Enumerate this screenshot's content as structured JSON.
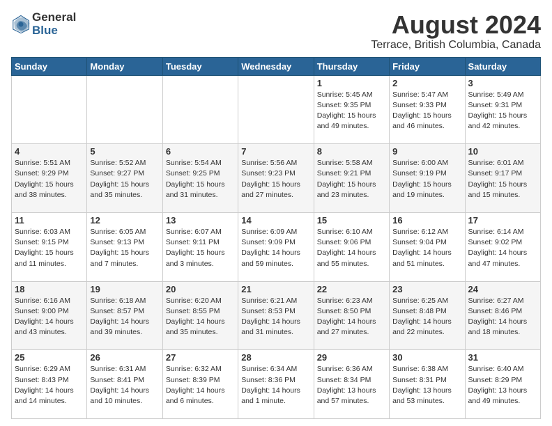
{
  "header": {
    "logo_line1": "General",
    "logo_line2": "Blue",
    "title": "August 2024",
    "subtitle": "Terrace, British Columbia, Canada"
  },
  "days_of_week": [
    "Sunday",
    "Monday",
    "Tuesday",
    "Wednesday",
    "Thursday",
    "Friday",
    "Saturday"
  ],
  "weeks": [
    [
      {
        "day": "",
        "info": ""
      },
      {
        "day": "",
        "info": ""
      },
      {
        "day": "",
        "info": ""
      },
      {
        "day": "",
        "info": ""
      },
      {
        "day": "1",
        "info": "Sunrise: 5:45 AM\nSunset: 9:35 PM\nDaylight: 15 hours\nand 49 minutes."
      },
      {
        "day": "2",
        "info": "Sunrise: 5:47 AM\nSunset: 9:33 PM\nDaylight: 15 hours\nand 46 minutes."
      },
      {
        "day": "3",
        "info": "Sunrise: 5:49 AM\nSunset: 9:31 PM\nDaylight: 15 hours\nand 42 minutes."
      }
    ],
    [
      {
        "day": "4",
        "info": "Sunrise: 5:51 AM\nSunset: 9:29 PM\nDaylight: 15 hours\nand 38 minutes."
      },
      {
        "day": "5",
        "info": "Sunrise: 5:52 AM\nSunset: 9:27 PM\nDaylight: 15 hours\nand 35 minutes."
      },
      {
        "day": "6",
        "info": "Sunrise: 5:54 AM\nSunset: 9:25 PM\nDaylight: 15 hours\nand 31 minutes."
      },
      {
        "day": "7",
        "info": "Sunrise: 5:56 AM\nSunset: 9:23 PM\nDaylight: 15 hours\nand 27 minutes."
      },
      {
        "day": "8",
        "info": "Sunrise: 5:58 AM\nSunset: 9:21 PM\nDaylight: 15 hours\nand 23 minutes."
      },
      {
        "day": "9",
        "info": "Sunrise: 6:00 AM\nSunset: 9:19 PM\nDaylight: 15 hours\nand 19 minutes."
      },
      {
        "day": "10",
        "info": "Sunrise: 6:01 AM\nSunset: 9:17 PM\nDaylight: 15 hours\nand 15 minutes."
      }
    ],
    [
      {
        "day": "11",
        "info": "Sunrise: 6:03 AM\nSunset: 9:15 PM\nDaylight: 15 hours\nand 11 minutes."
      },
      {
        "day": "12",
        "info": "Sunrise: 6:05 AM\nSunset: 9:13 PM\nDaylight: 15 hours\nand 7 minutes."
      },
      {
        "day": "13",
        "info": "Sunrise: 6:07 AM\nSunset: 9:11 PM\nDaylight: 15 hours\nand 3 minutes."
      },
      {
        "day": "14",
        "info": "Sunrise: 6:09 AM\nSunset: 9:09 PM\nDaylight: 14 hours\nand 59 minutes."
      },
      {
        "day": "15",
        "info": "Sunrise: 6:10 AM\nSunset: 9:06 PM\nDaylight: 14 hours\nand 55 minutes."
      },
      {
        "day": "16",
        "info": "Sunrise: 6:12 AM\nSunset: 9:04 PM\nDaylight: 14 hours\nand 51 minutes."
      },
      {
        "day": "17",
        "info": "Sunrise: 6:14 AM\nSunset: 9:02 PM\nDaylight: 14 hours\nand 47 minutes."
      }
    ],
    [
      {
        "day": "18",
        "info": "Sunrise: 6:16 AM\nSunset: 9:00 PM\nDaylight: 14 hours\nand 43 minutes."
      },
      {
        "day": "19",
        "info": "Sunrise: 6:18 AM\nSunset: 8:57 PM\nDaylight: 14 hours\nand 39 minutes."
      },
      {
        "day": "20",
        "info": "Sunrise: 6:20 AM\nSunset: 8:55 PM\nDaylight: 14 hours\nand 35 minutes."
      },
      {
        "day": "21",
        "info": "Sunrise: 6:21 AM\nSunset: 8:53 PM\nDaylight: 14 hours\nand 31 minutes."
      },
      {
        "day": "22",
        "info": "Sunrise: 6:23 AM\nSunset: 8:50 PM\nDaylight: 14 hours\nand 27 minutes."
      },
      {
        "day": "23",
        "info": "Sunrise: 6:25 AM\nSunset: 8:48 PM\nDaylight: 14 hours\nand 22 minutes."
      },
      {
        "day": "24",
        "info": "Sunrise: 6:27 AM\nSunset: 8:46 PM\nDaylight: 14 hours\nand 18 minutes."
      }
    ],
    [
      {
        "day": "25",
        "info": "Sunrise: 6:29 AM\nSunset: 8:43 PM\nDaylight: 14 hours\nand 14 minutes."
      },
      {
        "day": "26",
        "info": "Sunrise: 6:31 AM\nSunset: 8:41 PM\nDaylight: 14 hours\nand 10 minutes."
      },
      {
        "day": "27",
        "info": "Sunrise: 6:32 AM\nSunset: 8:39 PM\nDaylight: 14 hours\nand 6 minutes."
      },
      {
        "day": "28",
        "info": "Sunrise: 6:34 AM\nSunset: 8:36 PM\nDaylight: 14 hours\nand 1 minute."
      },
      {
        "day": "29",
        "info": "Sunrise: 6:36 AM\nSunset: 8:34 PM\nDaylight: 13 hours\nand 57 minutes."
      },
      {
        "day": "30",
        "info": "Sunrise: 6:38 AM\nSunset: 8:31 PM\nDaylight: 13 hours\nand 53 minutes."
      },
      {
        "day": "31",
        "info": "Sunrise: 6:40 AM\nSunset: 8:29 PM\nDaylight: 13 hours\nand 49 minutes."
      }
    ]
  ]
}
